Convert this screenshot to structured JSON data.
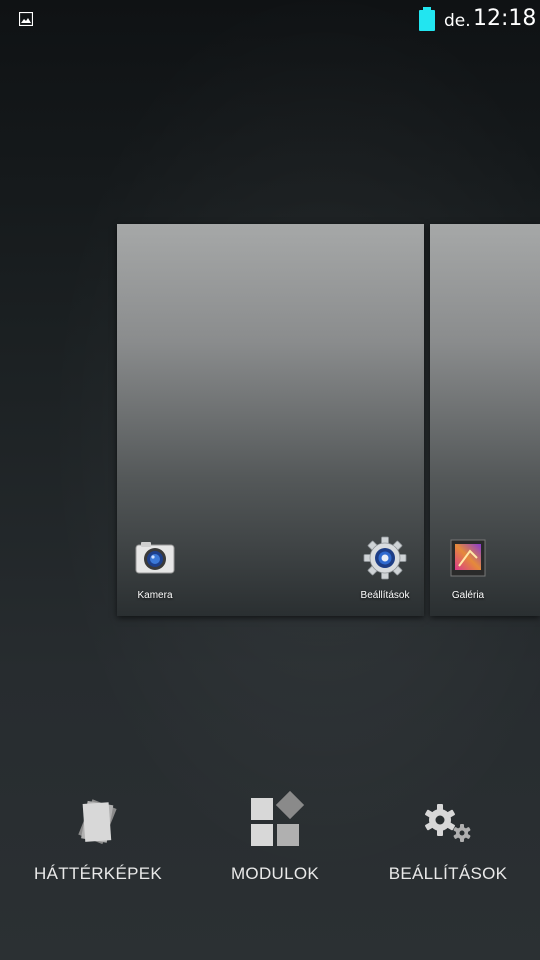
{
  "status_bar": {
    "ampm": "de.",
    "time": "12:18",
    "battery_color": "#22e5f0",
    "notification_icon": "image-icon"
  },
  "pages": [
    {
      "apps": [
        {
          "label": "Kamera",
          "icon": "camera-icon"
        },
        {
          "label": "Beállítások",
          "icon": "settings-gear-icon"
        }
      ]
    },
    {
      "apps": [
        {
          "label": "Galéria",
          "icon": "gallery-icon"
        }
      ]
    }
  ],
  "options": [
    {
      "label": "HÁTTÉRKÉPEK",
      "icon": "wallpapers-icon"
    },
    {
      "label": "MODULOK",
      "icon": "widgets-icon"
    },
    {
      "label": "BEÁLLÍTÁSOK",
      "icon": "settings-icon"
    }
  ]
}
